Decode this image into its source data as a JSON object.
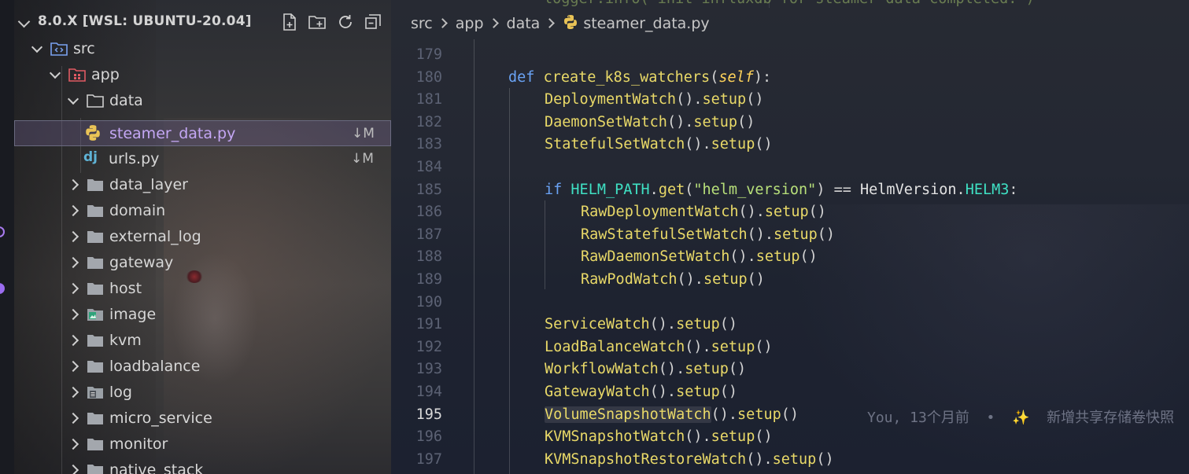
{
  "explorer": {
    "workspace_title": "8.0.X [WSL: UBUNTU-20.04]",
    "actions": [
      {
        "name": "new-file-icon"
      },
      {
        "name": "new-folder-icon"
      },
      {
        "name": "refresh-icon"
      },
      {
        "name": "collapse-all-icon"
      }
    ],
    "tree": [
      {
        "label": "src",
        "kind": "folder-src",
        "expanded": true
      },
      {
        "label": "app",
        "kind": "folder-app",
        "expanded": true
      },
      {
        "label": "data",
        "kind": "folder",
        "expanded": true
      },
      {
        "label": "steamer_data.py",
        "kind": "python",
        "git": "↓M",
        "selected": true
      },
      {
        "label": "urls.py",
        "kind": "django",
        "git": "↓M"
      },
      {
        "label": "data_layer",
        "kind": "folder"
      },
      {
        "label": "domain",
        "kind": "folder"
      },
      {
        "label": "external_log",
        "kind": "folder"
      },
      {
        "label": "gateway",
        "kind": "folder"
      },
      {
        "label": "host",
        "kind": "folder"
      },
      {
        "label": "image",
        "kind": "folder-image"
      },
      {
        "label": "kvm",
        "kind": "folder"
      },
      {
        "label": "loadbalance",
        "kind": "folder"
      },
      {
        "label": "log",
        "kind": "folder-log"
      },
      {
        "label": "micro_service",
        "kind": "folder"
      },
      {
        "label": "monitor",
        "kind": "folder"
      },
      {
        "label": "native_stack",
        "kind": "folder"
      }
    ]
  },
  "editor": {
    "breadcrumb": [
      "src",
      "app",
      "data",
      "steamer_data.py"
    ],
    "ghost_line": "logger.info(\"init influxdb for steamer data completed.\")",
    "current_line": "195",
    "blame": {
      "author": "You, 13个月前",
      "separator": "•",
      "sparkle": "✨",
      "message": "新增共享存储卷快照"
    },
    "lines": [
      {
        "n": "179",
        "tokens": []
      },
      {
        "n": "180",
        "tokens": [
          [
            "kw",
            "def "
          ],
          [
            "fn",
            "create_k8s_watchers"
          ],
          [
            "pun",
            "("
          ],
          [
            "self",
            "self"
          ],
          [
            "pun",
            "):"
          ]
        ]
      },
      {
        "n": "181",
        "tokens": [
          [
            "cls",
            "DeploymentWatch"
          ],
          [
            "pun",
            "()."
          ],
          [
            "fn",
            "setup"
          ],
          [
            "pun",
            "()"
          ]
        ]
      },
      {
        "n": "182",
        "tokens": [
          [
            "cls",
            "DaemonSetWatch"
          ],
          [
            "pun",
            "()."
          ],
          [
            "fn",
            "setup"
          ],
          [
            "pun",
            "()"
          ]
        ]
      },
      {
        "n": "183",
        "tokens": [
          [
            "cls",
            "StatefulSetWatch"
          ],
          [
            "pun",
            "()."
          ],
          [
            "fn",
            "setup"
          ],
          [
            "pun",
            "()"
          ]
        ]
      },
      {
        "n": "184",
        "tokens": []
      },
      {
        "n": "185",
        "tokens": [
          [
            "kw",
            "if "
          ],
          [
            "const",
            "HELM_PATH"
          ],
          [
            "pun",
            "."
          ],
          [
            "fn",
            "get"
          ],
          [
            "pun",
            "("
          ],
          [
            "str",
            "\"helm_version\""
          ],
          [
            "pun",
            ") == "
          ],
          [
            "name",
            "HelmVersion"
          ],
          [
            "pun",
            "."
          ],
          [
            "const",
            "HELM3"
          ],
          [
            "pun",
            ":"
          ]
        ]
      },
      {
        "n": "186",
        "tokens": [
          [
            "cls",
            "RawDeploymentWatch"
          ],
          [
            "pun",
            "()."
          ],
          [
            "fn",
            "setup"
          ],
          [
            "pun",
            "()"
          ]
        ]
      },
      {
        "n": "187",
        "tokens": [
          [
            "cls",
            "RawStatefulSetWatch"
          ],
          [
            "pun",
            "()."
          ],
          [
            "fn",
            "setup"
          ],
          [
            "pun",
            "()"
          ]
        ]
      },
      {
        "n": "188",
        "tokens": [
          [
            "cls",
            "RawDaemonSetWatch"
          ],
          [
            "pun",
            "()."
          ],
          [
            "fn",
            "setup"
          ],
          [
            "pun",
            "()"
          ]
        ]
      },
      {
        "n": "189",
        "tokens": [
          [
            "cls",
            "RawPodWatch"
          ],
          [
            "pun",
            "()."
          ],
          [
            "fn",
            "setup"
          ],
          [
            "pun",
            "()"
          ]
        ]
      },
      {
        "n": "190",
        "tokens": []
      },
      {
        "n": "191",
        "tokens": [
          [
            "cls",
            "ServiceWatch"
          ],
          [
            "pun",
            "()."
          ],
          [
            "fn",
            "setup"
          ],
          [
            "pun",
            "()"
          ]
        ]
      },
      {
        "n": "192",
        "tokens": [
          [
            "cls",
            "LoadBalanceWatch"
          ],
          [
            "pun",
            "()."
          ],
          [
            "fn",
            "setup"
          ],
          [
            "pun",
            "()"
          ]
        ]
      },
      {
        "n": "193",
        "tokens": [
          [
            "cls",
            "WorkflowWatch"
          ],
          [
            "pun",
            "()."
          ],
          [
            "fn",
            "setup"
          ],
          [
            "pun",
            "()"
          ]
        ]
      },
      {
        "n": "194",
        "tokens": [
          [
            "cls",
            "GatewayWatch"
          ],
          [
            "pun",
            "()."
          ],
          [
            "fn",
            "setup"
          ],
          [
            "pun",
            "()"
          ]
        ]
      },
      {
        "n": "195",
        "tokens": [
          [
            "cls",
            "VolumeSnapshotWatch"
          ],
          [
            "pun",
            "()."
          ],
          [
            "fn",
            "setup"
          ],
          [
            "pun",
            "()"
          ]
        ]
      },
      {
        "n": "196",
        "tokens": [
          [
            "cls",
            "KVMSnapshotWatch"
          ],
          [
            "pun",
            "()."
          ],
          [
            "fn",
            "setup"
          ],
          [
            "pun",
            "()"
          ]
        ]
      },
      {
        "n": "197",
        "tokens": [
          [
            "cls",
            "KVMSnapshotRestoreWatch"
          ],
          [
            "pun",
            "()."
          ],
          [
            "fn",
            "setup"
          ],
          [
            "pun",
            "()"
          ]
        ]
      }
    ]
  },
  "colors": {
    "accent": "#c4a7f4",
    "keyword": "#6aa3f5",
    "function": "#e9d968",
    "string": "#b8e07a",
    "constant": "#3fe1c4"
  }
}
